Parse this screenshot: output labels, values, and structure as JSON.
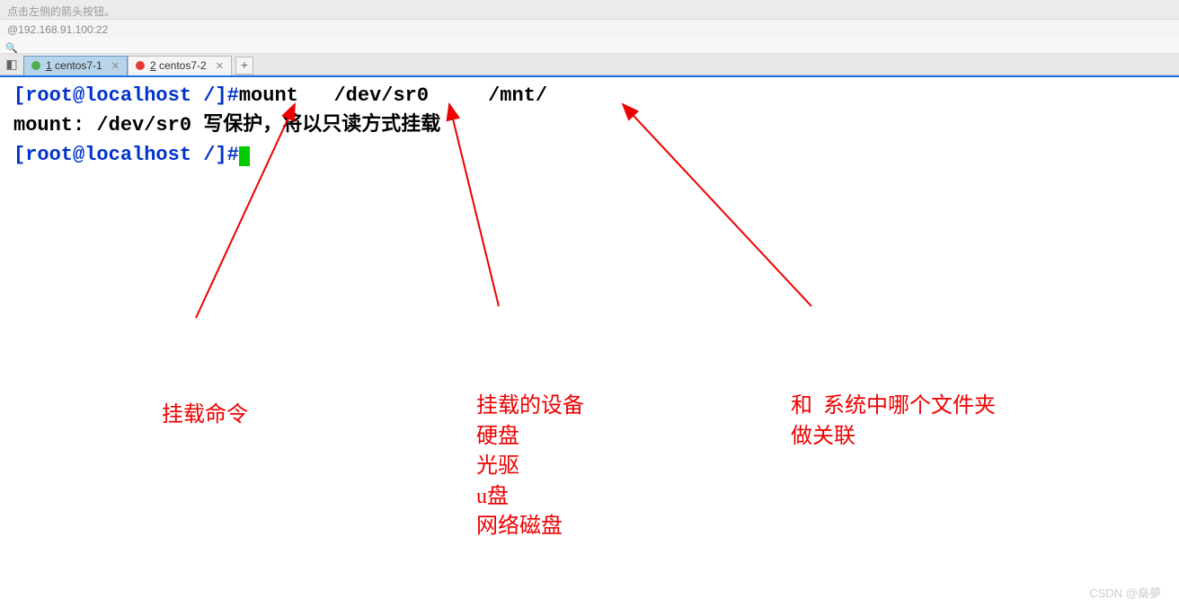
{
  "topBar": {
    "hint": "点击左侧的箭头按钮。"
  },
  "addressBar": {
    "text": "@192.168.91.100:22"
  },
  "tabs": [
    {
      "prefix": "1",
      "label": " centos7-1",
      "active": true,
      "color": "green"
    },
    {
      "prefix": "2",
      "label": " centos7-2",
      "active": false,
      "color": "red"
    }
  ],
  "terminal": {
    "line1": {
      "prompt": "[root@localhost /]#",
      "cmd": "mount   /dev/sr0     /mnt/"
    },
    "line2": "mount: /dev/sr0 写保护，将以只读方式挂载",
    "line3": {
      "prompt": "[root@localhost /]#"
    }
  },
  "annotations": {
    "a1": "挂载命令",
    "a2": "挂载的设备\n硬盘\n光驱\nu盘\n网络磁盘",
    "a3": "和  系统中哪个文件夹\n做关联"
  },
  "watermark": "CSDN @燊夢"
}
